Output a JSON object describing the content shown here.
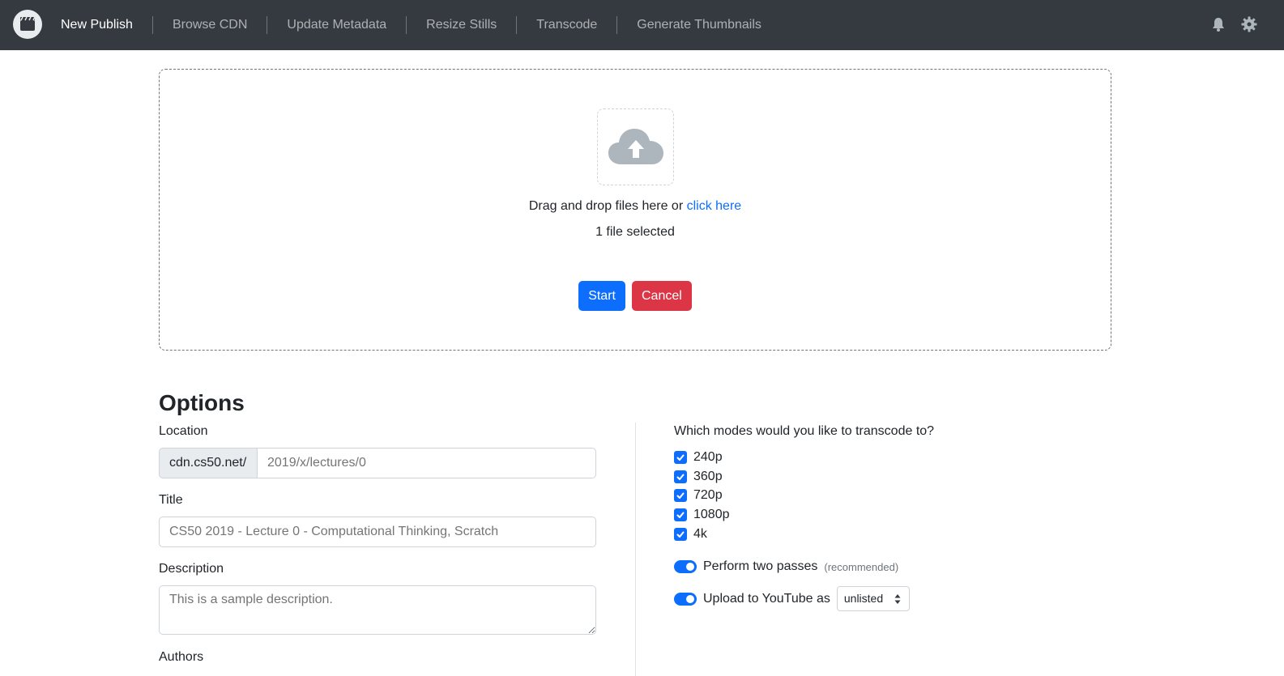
{
  "navbar": {
    "logo_icon": "clapperboard-icon",
    "items": [
      {
        "label": "New Publish",
        "active": true
      },
      {
        "label": "Browse CDN",
        "active": false
      },
      {
        "label": "Update Metadata",
        "active": false
      },
      {
        "label": "Resize Stills",
        "active": false
      },
      {
        "label": "Transcode",
        "active": false
      },
      {
        "label": "Generate Thumbnails",
        "active": false
      }
    ],
    "icons": [
      "bell-icon",
      "gear-icon"
    ]
  },
  "dropzone": {
    "icon": "cloud-upload-icon",
    "text": "Drag and drop files here or ",
    "link": "click here",
    "file_count": "1 file selected",
    "start_label": "Start",
    "cancel_label": "Cancel"
  },
  "options": {
    "title": "Options",
    "location_label": "Location",
    "location_prefix": "cdn.cs50.net/",
    "location_value": "2019/x/lectures/0",
    "title_label": "Title",
    "title_value": "CS50 2019 - Lecture 0 - Computational Thinking, Scratch",
    "description_label": "Description",
    "description_value": "This is a sample description.",
    "authors_label": "Authors",
    "modes_question": "Which modes would you like to transcode to?",
    "modes": [
      {
        "label": "240p",
        "checked": true
      },
      {
        "label": "360p",
        "checked": true
      },
      {
        "label": "720p",
        "checked": true
      },
      {
        "label": "1080p",
        "checked": true
      },
      {
        "label": "4k",
        "checked": true
      }
    ],
    "two_passes_label": "Perform two passes",
    "two_passes_note": "(recommended)",
    "two_passes_on": true,
    "youtube_label": "Upload to YouTube as",
    "youtube_on": true,
    "youtube_privacy": "unlisted"
  },
  "colors": {
    "navbar_bg": "#343a40",
    "primary": "#0d6efd",
    "danger": "#dc3545"
  }
}
